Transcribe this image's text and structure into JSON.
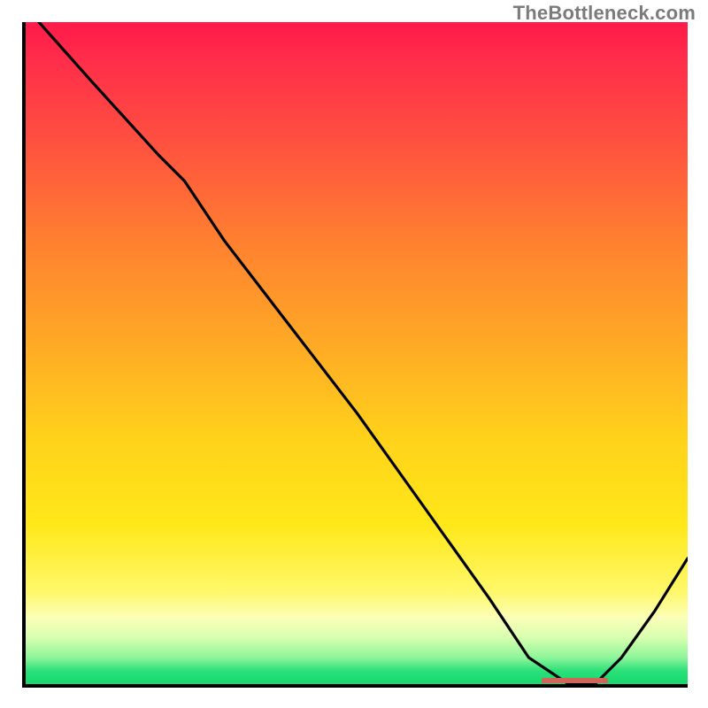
{
  "attribution": "TheBottleneck.com",
  "colors": {
    "curve": "#000000",
    "marker": "#d0655a",
    "axis": "#000000"
  },
  "chart_data": {
    "type": "line",
    "title": "",
    "xlabel": "",
    "ylabel": "",
    "xlim": [
      0,
      100
    ],
    "ylim": [
      0,
      100
    ],
    "grid": false,
    "legend": false,
    "background_gradient": {
      "orientation": "vertical",
      "stops": [
        {
          "pos": 0.0,
          "color": "#ff1a4a"
        },
        {
          "pos": 0.33,
          "color": "#ff8030"
        },
        {
          "pos": 0.63,
          "color": "#ffd21a"
        },
        {
          "pos": 0.86,
          "color": "#fff86a"
        },
        {
          "pos": 0.96,
          "color": "#8ef59a"
        },
        {
          "pos": 1.0,
          "color": "#15d86c"
        }
      ]
    },
    "series": [
      {
        "name": "bottleneck-curve",
        "x": [
          2,
          10,
          20,
          24,
          30,
          40,
          50,
          60,
          70,
          76,
          82,
          86,
          90,
          95,
          100
        ],
        "y": [
          100,
          91,
          80,
          76,
          67,
          54,
          41,
          27,
          13,
          4,
          0,
          0,
          4,
          11,
          19
        ]
      }
    ],
    "marker": {
      "x_start": 78,
      "x_end": 88,
      "y": 0
    }
  }
}
